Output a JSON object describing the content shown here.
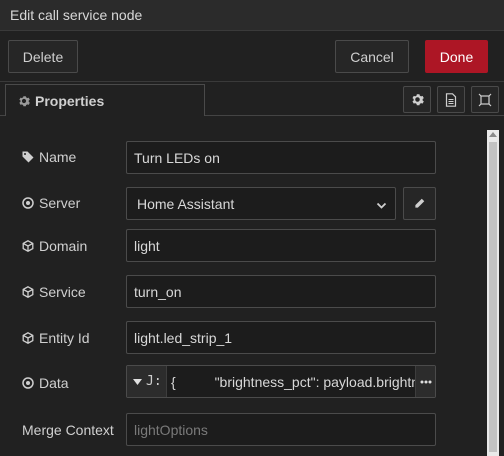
{
  "dialog": {
    "title": "Edit call service node"
  },
  "toolbar": {
    "delete_label": "Delete",
    "cancel_label": "Cancel",
    "done_label": "Done"
  },
  "tabs": {
    "properties_label": "Properties"
  },
  "form": {
    "name": {
      "label": "Name",
      "value": "Turn LEDs on"
    },
    "server": {
      "label": "Server",
      "value": "Home Assistant"
    },
    "domain": {
      "label": "Domain",
      "value": "light"
    },
    "service": {
      "label": "Service",
      "value": "turn_on"
    },
    "entity": {
      "label": "Entity Id",
      "value": "light.led_strip_1"
    },
    "data": {
      "label": "Data",
      "type_label": "J:",
      "value": "{          \"brightness_pct\": payload.brightness"
    },
    "merge_context": {
      "label": "Merge Context",
      "placeholder": "lightOptions"
    }
  },
  "colors": {
    "done_button": "#ad1625",
    "background": "#212121"
  }
}
